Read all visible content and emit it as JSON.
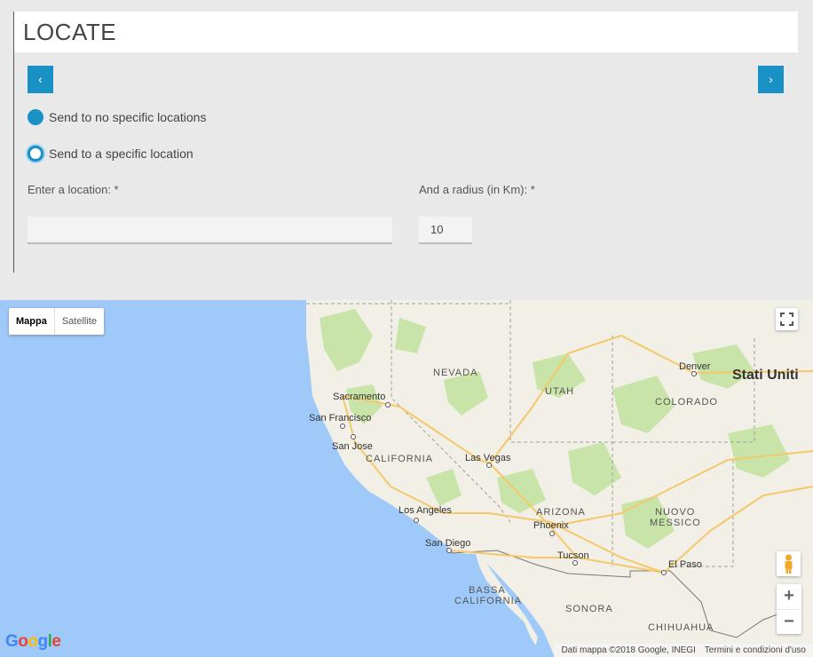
{
  "header": {
    "title": "LOCATE"
  },
  "nav": {
    "prev_label": "‹",
    "next_label": "›"
  },
  "options": {
    "no_specific": "Send to no specific locations",
    "specific": "Send to a specific location"
  },
  "form": {
    "location_label": "Enter a location: *",
    "location_value": "",
    "radius_label": "And a radius (in Km): *",
    "radius_value": "10"
  },
  "map": {
    "type_controls": [
      "Mappa",
      "Satellite"
    ],
    "zoom_in": "+",
    "zoom_out": "−",
    "country_label": "Stati Uniti",
    "state_labels": [
      "NEVADA",
      "UTAH",
      "COLORADO",
      "CALIFORNIA",
      "ARIZONA",
      "NUOVO",
      "MESSICO",
      "BASSA",
      "CALIFORNIA",
      "SONORA",
      "CHIHUAHUA"
    ],
    "cities": [
      "Sacramento",
      "San Francisco",
      "San Jose",
      "Las Vegas",
      "Los Angeles",
      "San Diego",
      "Phoenix",
      "Tucson",
      "El Paso",
      "Denver"
    ],
    "attribution_data": "Dati mappa ©2018 Google, INEGI",
    "attribution_terms": "Termini e condizioni d'uso",
    "logo_text": "Google"
  },
  "colors": {
    "accent": "#1a91c4",
    "ocean": "#9fc9f9",
    "land": "#f1efe6",
    "park": "#c8e4a8"
  }
}
